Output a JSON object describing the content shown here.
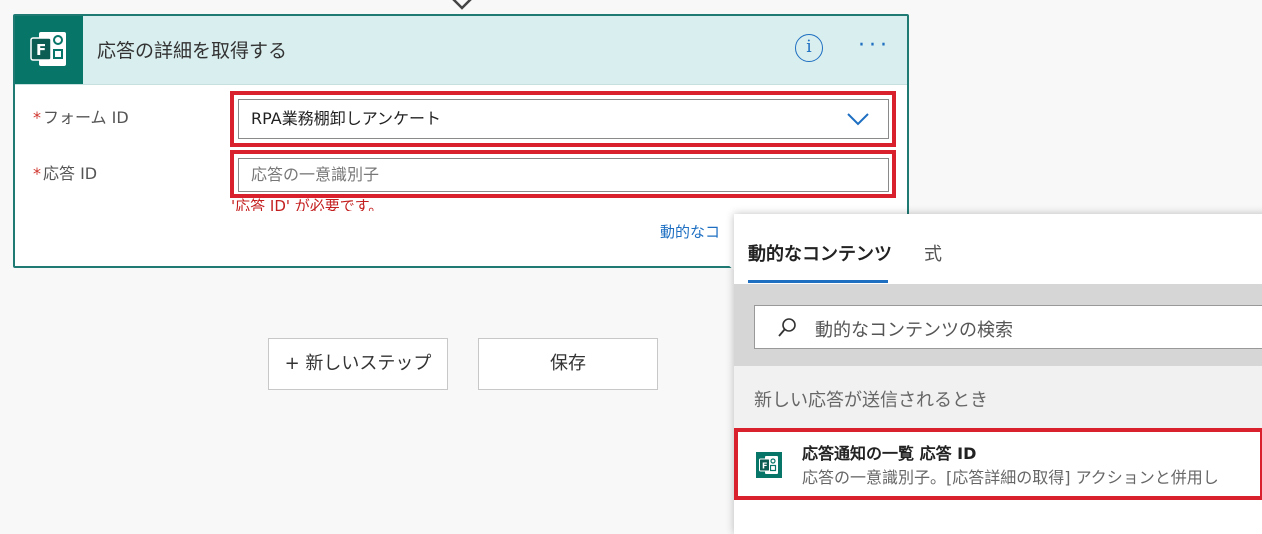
{
  "card": {
    "title": "応答の詳細を取得する",
    "info_label": "i",
    "more_label": "···",
    "form_field": {
      "required_mark": "*",
      "label": "フォーム ID",
      "value": "RPA業務棚卸しアンケート"
    },
    "response_field": {
      "required_mark": "*",
      "label": "応答 ID",
      "placeholder": "応答の一意識別子"
    },
    "error_text": "'応答 ID' が必要です。",
    "dynamic_link": "動的なコ"
  },
  "buttons": {
    "new_step": "+ 新しいステップ",
    "save": "保存"
  },
  "popup": {
    "tabs": [
      {
        "label": "動的なコンテンツ",
        "active": true
      },
      {
        "label": "式",
        "active": false
      }
    ],
    "search_placeholder": "動的なコンテンツの検索",
    "section_title": "新しい応答が送信されるとき",
    "item": {
      "title": "応答通知の一覧 応答 ID",
      "description": "応答の一意識別子。[応答詳細の取得] アクションと併用し"
    }
  },
  "colors": {
    "forms_green": "#077568",
    "card_border": "#1f7a74",
    "header_bg": "#d9eeee",
    "accent_blue": "#1e6fc2",
    "highlight_red": "#d9212e",
    "error_red": "#c41f1f"
  },
  "icons": [
    "down-arrow-icon",
    "forms-icon",
    "info-icon",
    "more-icon",
    "chevron-down-icon",
    "search-icon"
  ]
}
